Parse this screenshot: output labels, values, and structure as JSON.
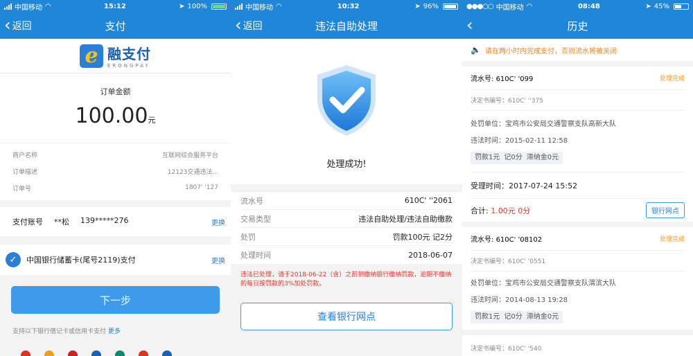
{
  "panel1": {
    "status": {
      "carrier": "中国移动",
      "time": "15:12",
      "battery": "100%"
    },
    "nav": {
      "back": "返回",
      "title": "支付"
    },
    "logo": {
      "name": "融支付",
      "sub": "ERONGPAY"
    },
    "amount_label": "订单金额",
    "amount": "100.00",
    "amount_unit": "元",
    "details": [
      {
        "label": "商户名称",
        "value": "互联网综合服务平台"
      },
      {
        "label": "订单描述",
        "value": "12123交通违法..."
      },
      {
        "label": "订单号",
        "value": "1807'         '127"
      }
    ],
    "account": {
      "label": "支付账号",
      "name": "**松",
      "phone": "139*****276",
      "action": "更换"
    },
    "card": {
      "text": "中国银行储蓄卡(尾号2119)支付",
      "action": "更换"
    },
    "next_button": "下一步",
    "support": {
      "text": "支持以下银行借记卡或信用卡支付",
      "more": "更多"
    }
  },
  "panel2": {
    "status": {
      "carrier": "中国移动",
      "time": "10:32",
      "battery": "96%"
    },
    "nav": {
      "back": "返回",
      "title": "违法自助处理"
    },
    "success": "处理成功!",
    "rows": [
      {
        "label": "流水号",
        "value": "610C'         ''2061"
      },
      {
        "label": "交易类型",
        "value": "违法自助处理/违法自助缴款"
      },
      {
        "label": "处罚",
        "value": "罚款100元  记2分"
      },
      {
        "label": "处理时间",
        "value": "2018-06-07"
      }
    ],
    "notice": "违法已处理，请于2018-06-22（含）之前到缴纳银行缴纳罚款，逾期不缴纳的每日按罚款的3%加处罚款。",
    "button": "查看银行网点"
  },
  "panel3": {
    "status": {
      "carrier": "中国移动",
      "time": "08:48",
      "battery": "45%"
    },
    "nav": {
      "title": "历史"
    },
    "warning": "请在两小时内完成支付，否则流水将被关闭",
    "records": [
      {
        "serial_label": "流水号:",
        "serial": "610C'           '099",
        "status": "处理完成",
        "decision": "决定书编号：610C'           ''375",
        "unit": "处罚单位：宝鸡市公安局交通警察支队高新大队",
        "time": "违法时间：2015-02-11 12:58",
        "tags": [
          "罚款1元",
          "记0分",
          "滞纳金0元"
        ],
        "accept": "受理时间：2017-07-24 15:52",
        "total_label": "合计:",
        "total_amount": "1.00元",
        "total_points": "0分",
        "button": "银行网点"
      },
      {
        "serial_label": "流水号:",
        "serial": "610C'          '08102",
        "status": "处理完成",
        "decision": "决定书编号：610C'          '0551",
        "unit": "处罚单位：宝鸡市公安局交通警察支队渭滨大队",
        "time": "违法时间：2014-08-13 19:28",
        "tags": [
          "罚款1元",
          "记0分",
          "滞纳金0元"
        ]
      }
    ],
    "decision3": "决定书编号：610C'          '540"
  }
}
